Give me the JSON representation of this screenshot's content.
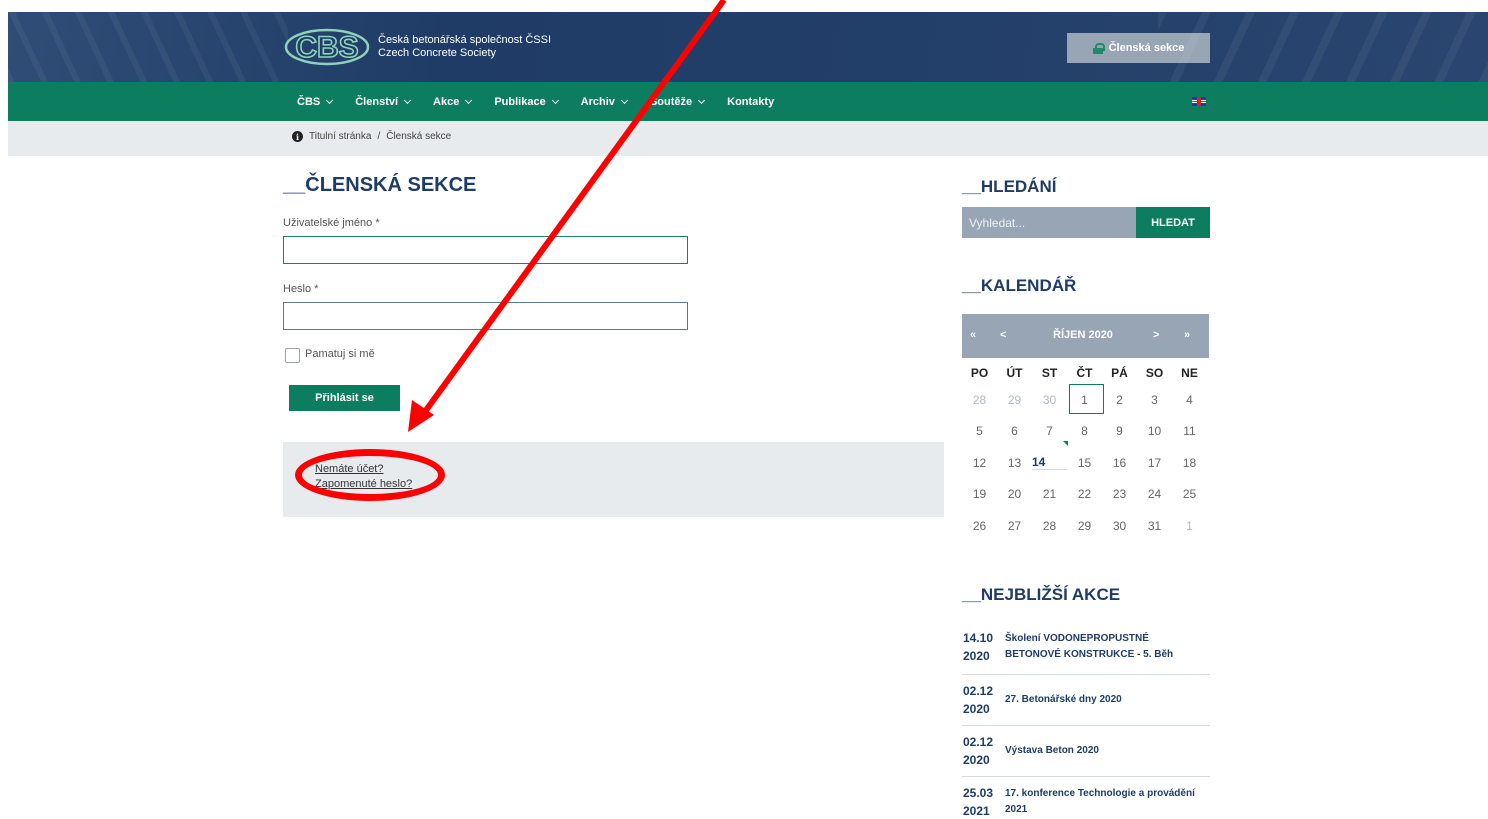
{
  "header": {
    "logo_text": "CBS",
    "org_name_cz": "Česká betonářská společnost ČSSI",
    "org_name_en": "Czech Concrete Society",
    "member_button": "Členská sekce"
  },
  "nav": {
    "items": [
      {
        "label": "ČBS",
        "dropdown": true
      },
      {
        "label": "Členství",
        "dropdown": true
      },
      {
        "label": "Akce",
        "dropdown": true
      },
      {
        "label": "Publikace",
        "dropdown": true
      },
      {
        "label": "Archiv",
        "dropdown": true
      },
      {
        "label": "Soutěže",
        "dropdown": true
      },
      {
        "label": "Kontakty",
        "dropdown": false
      }
    ],
    "language_icon": "uk-flag-icon"
  },
  "breadcrumb": {
    "home": "Titulní stránka",
    "separator": "/",
    "current": "Členská sekce"
  },
  "login": {
    "title": "__ČLENSKÁ SEKCE",
    "username_label": "Uživatelské jméno *",
    "username_value": "",
    "password_label": "Heslo *",
    "password_value": "",
    "remember_label": "Pamatuj si mě",
    "submit_label": "Přihlásit se",
    "links": [
      "Nemáte účet?",
      "Zapomenuté heslo?"
    ]
  },
  "search": {
    "title": "__HLEDÁNÍ",
    "placeholder": "Vyhledat...",
    "button": "HLEDAT"
  },
  "calendar": {
    "title": "__KALENDÁŘ",
    "prev_year": "«",
    "prev_month": "<",
    "month_label": "ŘÍJEN 2020",
    "next_month": ">",
    "next_year": "»",
    "weekdays": [
      "PO",
      "ÚT",
      "ST",
      "ČT",
      "PÁ",
      "SO",
      "NE"
    ],
    "weeks": [
      [
        "28",
        "29",
        "30",
        "1",
        "2",
        "3",
        "4"
      ],
      [
        "5",
        "6",
        "7",
        "8",
        "9",
        "10",
        "11"
      ],
      [
        "12",
        "13",
        "14",
        "15",
        "16",
        "17",
        "18"
      ],
      [
        "19",
        "20",
        "21",
        "22",
        "23",
        "24",
        "25"
      ],
      [
        "26",
        "27",
        "28",
        "29",
        "30",
        "31",
        "1"
      ]
    ]
  },
  "upcoming": {
    "title": "__NEJBLIŽŠÍ AKCE",
    "events": [
      {
        "day": "14.10",
        "year": "2020",
        "title": "Školení VODONEPROPUSTNÉ BETONOVÉ KONSTRUKCE - 5. Běh"
      },
      {
        "day": "02.12",
        "year": "2020",
        "title": "27. Betonářské dny 2020"
      },
      {
        "day": "02.12",
        "year": "2020",
        "title": "Výstava Beton 2020"
      },
      {
        "day": "25.03",
        "year": "2021",
        "title": "17. konference Technologie a provádění 2021"
      }
    ]
  },
  "colors": {
    "header_blue": "#1f3c66",
    "nav_green": "#0d7d5f",
    "annotation_red": "#ff0000"
  }
}
